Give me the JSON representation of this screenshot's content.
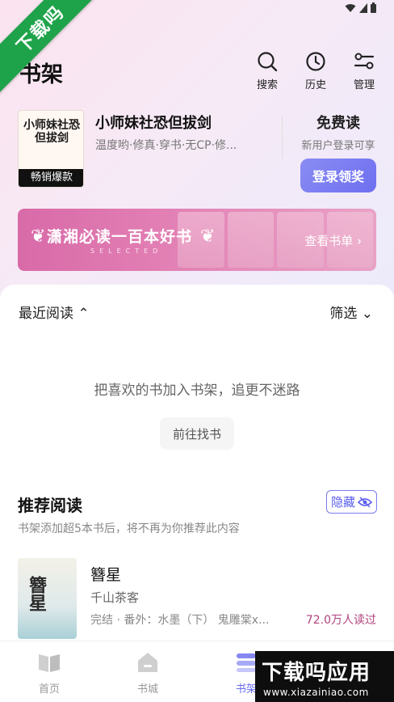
{
  "status_bar": {
    "icons": [
      "wifi-icon",
      "signal-icon",
      "battery-icon"
    ]
  },
  "watermark": {
    "corner_text": "下载吗",
    "brand_text": "下载吗应用",
    "url": "www.xiazainiao.com"
  },
  "header": {
    "title": "书架",
    "actions": [
      {
        "label": "搜索",
        "icon": "search-icon"
      },
      {
        "label": "历史",
        "icon": "clock-icon"
      },
      {
        "label": "管理",
        "icon": "manage-icon"
      }
    ]
  },
  "featured": {
    "cover_art_text": "小师妹社恐但拔剑",
    "badge": "畅销爆款",
    "title": "小师妹社恐但拔剑",
    "desc": "温度哟·修真·穿书·无CP·修...",
    "free_title": "免费读",
    "free_sub": "新用户登录可享",
    "login_button": "登录领奖"
  },
  "banner": {
    "title": "潇湘必读一百本好书",
    "sub": "SELECTED",
    "link": "查看书单 ›"
  },
  "shelf": {
    "sort_label": "最近阅读 ⌃",
    "filter_label": "筛选 ⌄",
    "empty_text": "把喜欢的书加入书架，追更不迷路",
    "find_button": "前往找书"
  },
  "recommend": {
    "title": "推荐阅读",
    "hide_button": "隐藏",
    "sub": "书架添加超5本书后，将不再为你推荐此内容",
    "book": {
      "cover_text": "簪星",
      "name": "簪星",
      "author": "千山茶客",
      "meta": "完结 · 番外：水墨（下） 鬼雕棠x...",
      "reads": "72.0万人读过"
    }
  },
  "bottom_nav": [
    {
      "label": "首页",
      "icon": "book-open-icon",
      "active": false
    },
    {
      "label": "书城",
      "icon": "store-icon",
      "active": false
    },
    {
      "label": "书架",
      "icon": "shelf-icon",
      "active": true
    }
  ],
  "colors": {
    "accent": "#6e6ff0",
    "banner": "#d86aa8",
    "reads": "#b0427c"
  }
}
